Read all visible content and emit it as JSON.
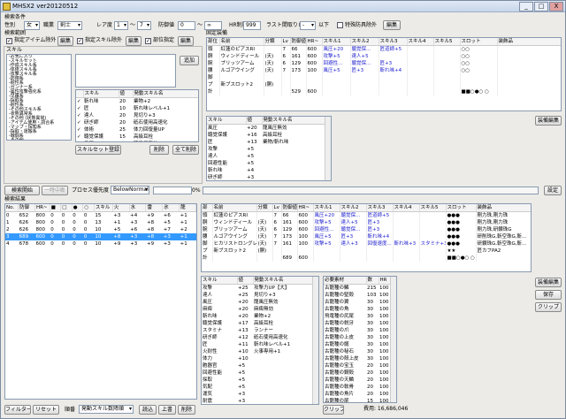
{
  "window": {
    "title": "MHSX2 ver20120512",
    "minimize": "_",
    "maximize": "□",
    "close": "X"
  },
  "search": {
    "section_label": "検索条件",
    "sex_label": "性別",
    "sex_value": "女",
    "type_label": "職業",
    "type_value": "剣士",
    "rare_label": "レア度",
    "rare_from": "1",
    "rare_sep": "～",
    "rare_to": "7",
    "defense_label": "防御値",
    "defense_from": "0",
    "defense_sep": "～",
    "defense_to": "∞",
    "hr_label": "HR制限",
    "hr_value": "999",
    "slot_label": "ラスト間取りレ",
    "slot_value": "-",
    "slot_suffix": "以下",
    "special_cb": "特殊防具除外",
    "special_btn": "編集",
    "range_label": "検索範囲",
    "designated_cb": "指定アイテム除外",
    "designated_btn": "編集",
    "skill_excl_cb": "指定スキル除外",
    "skill_excl_btn": "編集",
    "part_cb": "部位指定",
    "part_btn": "編集",
    "skill_label": "スキル",
    "add_btn": "追加",
    "skill_tree": [
      "-お気に入り",
      "-スキルセット",
      "-作成スキル系",
      "-体術スキル系",
      "-攻撃スキル系",
      "-防御系",
      "-耐性系",
      "-ガンナー系",
      "-属性攻撃強化系",
      "-早睡系",
      "-採取系",
      "-耐性系",
      "-その他スキル系",
      "-状態異常系",
      "-その他 (状態異常)",
      "-アイテム使用・調合系",
      "-マップ・探知系",
      "-採取・運搬系",
      "-戦闘系",
      "-その他"
    ],
    "skill_list_headers": [
      "スキル",
      "値",
      "発動スキル名"
    ],
    "skill_list": [
      {
        "check": "✓",
        "name": "斬れ味",
        "value": "20",
        "skill": "業物+2"
      },
      {
        "check": "✓",
        "name": "匠",
        "value": "10",
        "skill": "斬れ味レベル+1"
      },
      {
        "check": "✓",
        "name": "達人",
        "value": "20",
        "skill": "見切り+3"
      },
      {
        "check": "✓",
        "name": "研ぎ師",
        "value": "20",
        "skill": "砥石使用高速化"
      },
      {
        "check": "✓",
        "name": "体術",
        "value": "25",
        "skill": "体力回復量UP"
      },
      {
        "check": "✓",
        "name": "聴覚保護",
        "value": "15",
        "skill": "高級耳栓"
      },
      {
        "check": "✓",
        "name": "風圧",
        "value": "20",
        "skill": "龍風圧無効"
      },
      {
        "check": "✓",
        "name": "スタミナ",
        "value": "10",
        "skill": "ランナー"
      }
    ],
    "skillset_btn": "スキルセット登録",
    "delete_btn": "削除",
    "clear_all_btn": "全て削除"
  },
  "fixed_equip": {
    "label": "固定装備",
    "headers": [
      "部位",
      "名前",
      "分類",
      "Lv",
      "防御値",
      "HR~",
      "スキル1",
      "スキル2",
      "スキル3",
      "スキル4",
      "スキル5",
      "スロット",
      "装飾品"
    ],
    "rows": [
      {
        "part": "頭",
        "name": "紅蓮のピアスRI",
        "cls": "",
        "lv": "7",
        "def": "66",
        "hr": "600",
        "s1": "風圧+20",
        "s2": "聴覚保...",
        "s3": "匠道師+5",
        "s4": "",
        "s5": "",
        "slot": "○○",
        "deco": ""
      },
      {
        "part": "胴",
        "name": "ウィンドディール",
        "cls": "(天)",
        "lv": "6",
        "def": "161",
        "hr": "600",
        "s1": "攻撃+5",
        "s2": "達人+5",
        "s3": "",
        "s4": "",
        "s5": "",
        "slot": "○○",
        "deco": ""
      },
      {
        "part": "腕",
        "name": "ブリッツアーム",
        "cls": "(天)",
        "lv": "6",
        "def": "129",
        "hr": "600",
        "s1": "回避性...",
        "s2": "聴覚保...",
        "s3": "匠+3",
        "s4": "",
        "s5": "",
        "slot": "○○",
        "deco": ""
      },
      {
        "part": "腰",
        "name": "ルゴアウイング",
        "cls": "(天)",
        "lv": "7",
        "def": "173",
        "hr": "100",
        "s1": "風圧+5",
        "s2": "匠+3",
        "s3": "斬れ味+4",
        "s4": "",
        "s5": "",
        "slot": "○○",
        "deco": ""
      },
      {
        "part": "脚",
        "name": "",
        "cls": "",
        "lv": "",
        "def": "",
        "hr": "",
        "s1": "",
        "s2": "",
        "s3": "",
        "s4": "",
        "s5": "",
        "slot": "",
        "deco": ""
      },
      {
        "part": "プ",
        "name": "新ブスロット2",
        "cls": "(胴)",
        "lv": "",
        "def": "",
        "hr": "",
        "s1": "",
        "s2": "",
        "s3": "",
        "s4": "",
        "s5": "",
        "slot": "",
        "deco": ""
      },
      {
        "part": "計",
        "name": "",
        "cls": "",
        "lv": "",
        "def": "529",
        "hr": "600",
        "s1": "",
        "s2": "",
        "s3": "",
        "s4": "",
        "s5": "",
        "slot": "■■○●○ ○",
        "deco": ""
      }
    ],
    "skill_headers": [
      "スキル",
      "値",
      "発動スキル名"
    ],
    "skills": [
      {
        "name": "風圧",
        "value": "+20",
        "skill": "龍風圧無効"
      },
      {
        "name": "聴覚保護",
        "value": "+16",
        "skill": "高級耳栓"
      },
      {
        "name": "匠",
        "value": "+13",
        "skill": "業物/斬れ味"
      },
      {
        "name": "攻撃",
        "value": "+5",
        "skill": ""
      },
      {
        "name": "達人",
        "value": "+5",
        "skill": ""
      },
      {
        "name": "回避性能",
        "value": "+5",
        "skill": ""
      },
      {
        "name": "斬れ味",
        "value": "+4",
        "skill": ""
      },
      {
        "name": "研ぎ師",
        "value": "+3",
        "skill": ""
      }
    ],
    "edit_btn": "装備編集"
  },
  "progress": {
    "search_btn": "検索開始",
    "stop_btn": "一時中断",
    "priority_label": "プロセス優先度",
    "priority_value": "BelowNormal",
    "percent": "0%",
    "settings_btn": "設定"
  },
  "results": {
    "label": "検索結果",
    "headers": [
      "No.",
      "防御",
      "HR~",
      "■",
      "□",
      "●",
      "○",
      "スキル",
      "火",
      "水",
      "雷",
      "氷",
      "龍"
    ],
    "rows": [
      {
        "no": "0",
        "def": "652",
        "hr": "800",
        "a": "0",
        "b": "0",
        "c": "0",
        "d": "0",
        "sk": "15",
        "fire": "+3",
        "water": "+4",
        "thunder": "+9",
        "ice": "+6",
        "dragon": "+1"
      },
      {
        "no": "1",
        "def": "626",
        "hr": "800",
        "a": "0",
        "b": "0",
        "c": "0",
        "d": "0",
        "sk": "13",
        "fire": "+1",
        "water": "+3",
        "thunder": "+8",
        "ice": "+5",
        "dragon": "+1"
      },
      {
        "no": "2",
        "def": "626",
        "hr": "800",
        "a": "0",
        "b": "0",
        "c": "0",
        "d": "0",
        "sk": "10",
        "fire": "+5",
        "water": "+6",
        "thunder": "+8",
        "ice": "+7",
        "dragon": "+2"
      },
      {
        "no": "3",
        "def": "689",
        "hr": "600",
        "a": "0",
        "b": "0",
        "c": "0",
        "d": "0",
        "sk": "10",
        "fire": "+8",
        "water": "+3",
        "thunder": "+8",
        "ice": "+3",
        "dragon": "+1"
      },
      {
        "no": "4",
        "def": "678",
        "hr": "600",
        "a": "0",
        "b": "0",
        "c": "0",
        "d": "0",
        "sk": "10",
        "fire": "+9",
        "water": "+3",
        "thunder": "+9",
        "ice": "+3",
        "dragon": "+1"
      }
    ],
    "selected_index": 3,
    "detail_headers": [
      "部",
      "名前",
      "分類",
      "Lv",
      "防御値",
      "HR~",
      "スキル1",
      "スキル2",
      "スキル3",
      "スキル4",
      "スキル5",
      "スロット",
      "装飾品"
    ],
    "detail_rows": [
      {
        "part": "頭",
        "name": "紅蓮のピアスRI",
        "cls": "",
        "lv": "7",
        "def": "66",
        "hr": "600",
        "s1": "風圧+20",
        "s2": "聴覚保...",
        "s3": "匠道師+5",
        "s4": "",
        "s5": "",
        "slot": "●●●",
        "deco": "剛力珠,剛力珠"
      },
      {
        "part": "胴",
        "name": "ウィンドディール",
        "cls": "(天)",
        "lv": "6",
        "def": "161",
        "hr": "600",
        "s1": "攻撃+5",
        "s2": "達人+5",
        "s3": "匠+3",
        "s4": "",
        "s5": "",
        "slot": "●●●",
        "deco": "剛力珠,剛力珠"
      },
      {
        "part": "腕",
        "name": "ブリッツアーム",
        "cls": "(天)",
        "lv": "6",
        "def": "129",
        "hr": "600",
        "s1": "回避性...",
        "s2": "聴覚保...",
        "s3": "匠+3",
        "s4": "",
        "s5": "",
        "slot": "●●●",
        "deco": "剛力珠,研鑽珠G"
      },
      {
        "part": "腰",
        "name": "ルゴアウイング",
        "cls": "(天)",
        "lv": "7",
        "def": "173",
        "hr": "100",
        "s1": "風圧+5",
        "s2": "匠+3",
        "s3": "斬れ味+4",
        "s4": "",
        "s5": "",
        "slot": "●●●",
        "deco": "研削珠G,斬空珠G,斬..."
      },
      {
        "part": "脚",
        "name": "ヒカリストロングレ",
        "cls": "(天)",
        "lv": "7",
        "def": "161",
        "hr": "100",
        "s1": "攻撃+5",
        "s2": "達人+3",
        "s3": "回復速度...",
        "s4": "斬れ味+3",
        "s5": "スタミナ+3",
        "slot": "●●●",
        "deco": "研鑽珠G,斬空珠G,斬..."
      },
      {
        "part": "プ",
        "name": "新ブスロット2",
        "cls": "(胴)",
        "lv": "",
        "def": "",
        "hr": "",
        "s1": "",
        "s2": "",
        "s3": "",
        "s4": "",
        "s5": "",
        "slot": "★★",
        "deco": "匠カフPA2"
      },
      {
        "part": "計",
        "name": "",
        "cls": "",
        "lv": "",
        "def": "689",
        "hr": "600",
        "s1": "",
        "s2": "",
        "s3": "",
        "s4": "",
        "s5": "",
        "slot": "■■○●○ ○",
        "deco": ""
      }
    ],
    "skill_headers": [
      "スキル",
      "値",
      "発動スキル名"
    ],
    "skills": [
      {
        "name": "攻撃",
        "value": "+25",
        "skill": "攻撃力UP【大】"
      },
      {
        "name": "達人",
        "value": "+25",
        "skill": "見切り+3"
      },
      {
        "name": "風圧",
        "value": "+20",
        "skill": "龍風圧無効"
      },
      {
        "name": "麻痺",
        "value": "+20",
        "skill": "麻痺無効"
      },
      {
        "name": "斬れ味",
        "value": "+20",
        "skill": "業物+2"
      },
      {
        "name": "聴覚保護",
        "value": "+17",
        "skill": "高級耳栓"
      },
      {
        "name": "スタミナ",
        "value": "+13",
        "skill": "ランナー"
      },
      {
        "name": "研ぎ師",
        "value": "+12",
        "skill": "砥石使用高速化"
      },
      {
        "name": "匠",
        "value": "+11",
        "skill": "斬れ味レベル+1"
      },
      {
        "name": "火耐性",
        "value": "+10",
        "skill": "火事専用+1"
      },
      {
        "name": "体力",
        "value": "+10",
        "skill": ""
      },
      {
        "name": "胞器官",
        "value": "+5",
        "skill": ""
      },
      {
        "name": "回避性能",
        "value": "+5",
        "skill": ""
      },
      {
        "name": "採取",
        "value": "+5",
        "skill": ""
      },
      {
        "name": "気配",
        "value": "+5",
        "skill": ""
      },
      {
        "name": "運気",
        "value": "+3",
        "skill": ""
      },
      {
        "name": "耐震",
        "value": "+3",
        "skill": ""
      },
      {
        "name": "回復速度",
        "value": "+3",
        "skill": ""
      },
      {
        "name": "跳弾",
        "value": "+1",
        "skill": ""
      },
      {
        "name": "千里眼",
        "value": "-3",
        "skill": ""
      },
      {
        "name": "体力",
        "value": "-4",
        "skill": ""
      }
    ],
    "materials_headers": [
      "必要素材",
      "数",
      "HR"
    ],
    "materials": [
      {
        "name": "古龍種の鱗",
        "n": "215",
        "hr": "100"
      },
      {
        "name": "古龍種の堅殻",
        "n": "103",
        "hr": "100"
      },
      {
        "name": "古龍種の翼",
        "n": "30",
        "hr": "100"
      },
      {
        "name": "古龍種の角",
        "n": "30",
        "hr": "100"
      },
      {
        "name": "飛竜種の尻尾",
        "n": "30",
        "hr": "100"
      },
      {
        "name": "古龍種の鋭牙",
        "n": "30",
        "hr": "100"
      },
      {
        "name": "古龍種の爪",
        "n": "30",
        "hr": "100"
      },
      {
        "name": "古龍種の上皮",
        "n": "30",
        "hr": "100"
      },
      {
        "name": "古龍種の髄",
        "n": "30",
        "hr": "100"
      },
      {
        "name": "古龍種の秘石",
        "n": "30",
        "hr": "100"
      },
      {
        "name": "古龍種の殻上皮",
        "n": "30",
        "hr": "100"
      },
      {
        "name": "古龍種の宝玉",
        "n": "20",
        "hr": "100"
      },
      {
        "name": "古龍種の鋼殻",
        "n": "20",
        "hr": "100"
      },
      {
        "name": "古龍種の天鱗",
        "n": "20",
        "hr": "100"
      },
      {
        "name": "古龍種の軟骨",
        "n": "20",
        "hr": "100"
      },
      {
        "name": "古龍種の角片",
        "n": "20",
        "hr": "100"
      },
      {
        "name": "古龍種の尾",
        "n": "15",
        "hr": "100"
      },
      {
        "name": "古龍種の蒼角",
        "n": "15",
        "hr": "100"
      },
      {
        "name": "古龍種の逆鱗",
        "n": "10",
        "hr": "100"
      },
      {
        "name": "古龍種の重殻",
        "n": "10",
        "hr": "100"
      }
    ],
    "materials_copy_btn": "クリップ",
    "cost_label": "費用: 16,686,046",
    "equip_edit_btn": "装備編集",
    "save_btn": "保存",
    "clip_btn": "クリップ"
  },
  "bottom": {
    "filter_btn": "フィルター",
    "reset_btn": "リセット",
    "sort_label": "順番",
    "sort_value": "発動スキル数降順",
    "read_btn": "読込",
    "overwrite_btn": "上書",
    "delete_btn": "削除"
  }
}
